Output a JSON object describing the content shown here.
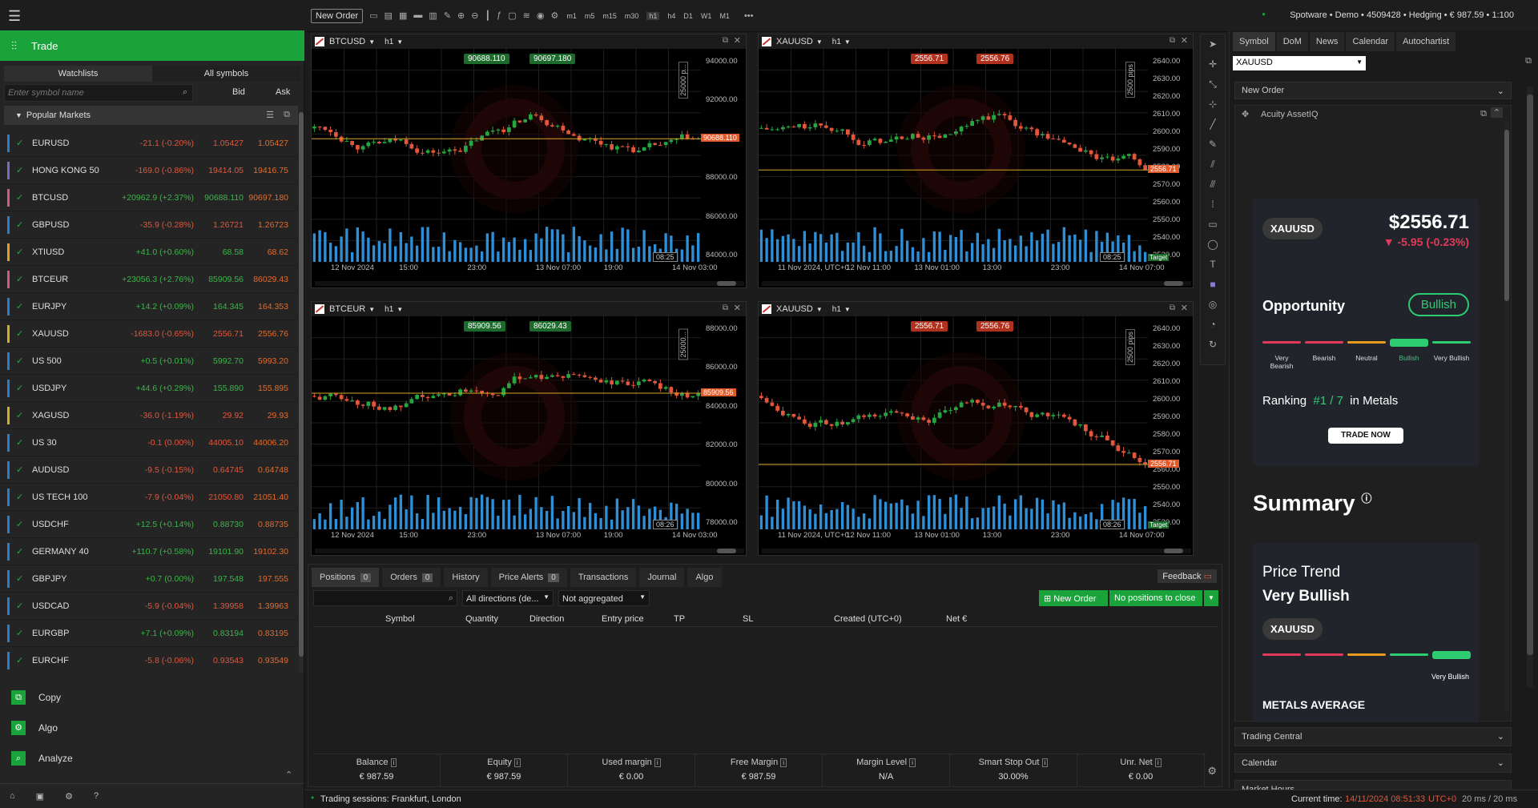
{
  "sidebar": {
    "trade_label": "Trade",
    "tabs": [
      "Watchlists",
      "All symbols"
    ],
    "search_placeholder": "Enter symbol name",
    "bid_label": "Bid",
    "ask_label": "Ask",
    "section_title": "Popular Markets",
    "markets": [
      {
        "symbol": "EURUSD",
        "change": "-21.1 (-0.20%)",
        "bid": "1.05427",
        "ask": "1.05427",
        "dir": "neg",
        "color": "#2a7cc7"
      },
      {
        "symbol": "HONG KONG 50",
        "change": "-169.0 (-0.86%)",
        "bid": "19414.05",
        "ask": "19416.75",
        "dir": "neg",
        "color": "#7f6ac2"
      },
      {
        "symbol": "BTCUSD",
        "change": "+20962.9 (+2.37%)",
        "bid": "90688.110",
        "ask": "90697.180",
        "dir": "pos",
        "color": "#d05a7a"
      },
      {
        "symbol": "GBPUSD",
        "change": "-35.9 (-0.28%)",
        "bid": "1.26721",
        "ask": "1.26723",
        "dir": "neg",
        "color": "#2a7cc7"
      },
      {
        "symbol": "XTIUSD",
        "change": "+41.0 (+0.60%)",
        "bid": "68.58",
        "ask": "68.62",
        "dir": "pos",
        "color": "#e0a020"
      },
      {
        "symbol": "BTCEUR",
        "change": "+23056.3 (+2.76%)",
        "bid": "85909.56",
        "ask": "86029.43",
        "dir": "pos",
        "color": "#d05a7a"
      },
      {
        "symbol": "EURJPY",
        "change": "+14.2 (+0.09%)",
        "bid": "164.345",
        "ask": "164.353",
        "dir": "pos",
        "color": "#2a7cc7"
      },
      {
        "symbol": "XAUUSD",
        "change": "-1683.0 (-0.65%)",
        "bid": "2556.71",
        "ask": "2556.76",
        "dir": "neg",
        "color": "#d0b020"
      },
      {
        "symbol": "US 500",
        "change": "+0.5 (+0.01%)",
        "bid": "5992.70",
        "ask": "5993.20",
        "dir": "pos",
        "color": "#2a7cc7"
      },
      {
        "symbol": "USDJPY",
        "change": "+44.6 (+0.29%)",
        "bid": "155.890",
        "ask": "155.895",
        "dir": "pos",
        "color": "#2a7cc7"
      },
      {
        "symbol": "XAGUSD",
        "change": "-36.0 (-1.19%)",
        "bid": "29.92",
        "ask": "29.93",
        "dir": "neg",
        "color": "#d0b020"
      },
      {
        "symbol": "US 30",
        "change": "-0.1 (0.00%)",
        "bid": "44005.10",
        "ask": "44006.20",
        "dir": "neg",
        "color": "#2a7cc7"
      },
      {
        "symbol": "AUDUSD",
        "change": "-9.5 (-0.15%)",
        "bid": "0.64745",
        "ask": "0.64748",
        "dir": "neg",
        "color": "#2a7cc7"
      },
      {
        "symbol": "US TECH 100",
        "change": "-7.9 (-0.04%)",
        "bid": "21050.80",
        "ask": "21051.40",
        "dir": "neg",
        "color": "#2a7cc7"
      },
      {
        "symbol": "USDCHF",
        "change": "+12.5 (+0.14%)",
        "bid": "0.88730",
        "ask": "0.88735",
        "dir": "pos",
        "color": "#2a7cc7"
      },
      {
        "symbol": "GERMANY 40",
        "change": "+110.7 (+0.58%)",
        "bid": "19101.90",
        "ask": "19102.30",
        "dir": "pos",
        "color": "#2a7cc7"
      },
      {
        "symbol": "GBPJPY",
        "change": "+0.7 (0.00%)",
        "bid": "197.548",
        "ask": "197.555",
        "dir": "pos",
        "color": "#2a7cc7"
      },
      {
        "symbol": "USDCAD",
        "change": "-5.9 (-0.04%)",
        "bid": "1.39958",
        "ask": "1.39963",
        "dir": "neg",
        "color": "#2a7cc7"
      },
      {
        "symbol": "EURGBP",
        "change": "+7.1 (+0.09%)",
        "bid": "0.83194",
        "ask": "0.83195",
        "dir": "pos",
        "color": "#2a7cc7"
      },
      {
        "symbol": "EURCHF",
        "change": "-5.8 (-0.06%)",
        "bid": "0.93543",
        "ask": "0.93549",
        "dir": "neg",
        "color": "#2a7cc7"
      }
    ],
    "bottom_nav": [
      "Copy",
      "Algo",
      "Analyze"
    ]
  },
  "topbar": {
    "new_order": "New Order",
    "timeframes": [
      "m1",
      "m5",
      "m15",
      "m30",
      "h1",
      "h4",
      "D1",
      "W1",
      "M1"
    ],
    "account": "Spotware • Demo • 4509428 • Hedging • € 987.59 • 1:100"
  },
  "charts": [
    {
      "symbol": "BTCUSD",
      "tf": "h1",
      "bid": "90688.110",
      "ask": "90697.180",
      "price_tag": "90688.110",
      "y_axis": [
        "94000.00",
        "92000.00",
        "90000.00",
        "88000.00",
        "86000.00",
        "84000.00"
      ],
      "x_axis": [
        "12 Nov 2024",
        "15:00",
        "23:00",
        "13 Nov 07:00",
        "19:00",
        "14 Nov 03:00"
      ],
      "pips": "25000 p...",
      "time_box": "08:25"
    },
    {
      "symbol": "XAUUSD",
      "tf": "h1",
      "bid": "2556.71",
      "ask": "2556.76",
      "price_tag": "2556.71",
      "y_axis": [
        "2640.00",
        "2630.00",
        "2620.00",
        "2610.00",
        "2600.00",
        "2590.00",
        "2580.00",
        "2570.00",
        "2560.00",
        "2550.00",
        "2540.00",
        "2530.00"
      ],
      "x_axis": [
        "11 Nov 2024, UTC+0",
        "12 Nov 11:00",
        "13 Nov 01:00",
        "13:00",
        "23:00",
        "14 Nov 07:00"
      ],
      "pips": "2500 pips",
      "time_box": "08:25",
      "target": "Target"
    },
    {
      "symbol": "BTCEUR",
      "tf": "h1",
      "bid": "85909.56",
      "ask": "86029.43",
      "price_tag": "85909.56",
      "y_axis": [
        "88000.00",
        "86000.00",
        "84000.00",
        "82000.00",
        "80000.00",
        "78000.00"
      ],
      "x_axis": [
        "12 Nov 2024",
        "15:00",
        "23:00",
        "13 Nov 07:00",
        "19:00",
        "14 Nov 03:00"
      ],
      "pips": "25000...",
      "time_box": "08:26"
    },
    {
      "symbol": "XAUUSD",
      "tf": "h1",
      "bid": "2556.71",
      "ask": "2556.76",
      "price_tag": "2556.71",
      "y_axis": [
        "2640.00",
        "2630.00",
        "2620.00",
        "2610.00",
        "2600.00",
        "2590.00",
        "2580.00",
        "2570.00",
        "2560.00",
        "2550.00",
        "2540.00",
        "2530.00"
      ],
      "x_axis": [
        "11 Nov 2024, UTC+0",
        "12 Nov 11:00",
        "13 Nov 01:00",
        "13:00",
        "23:00",
        "14 Nov 07:00"
      ],
      "pips": "2500 pips",
      "time_box": "08:26",
      "target": "Target"
    }
  ],
  "positions": {
    "tabs": [
      {
        "label": "Positions",
        "count": "0"
      },
      {
        "label": "Orders",
        "count": "0"
      },
      {
        "label": "History"
      },
      {
        "label": "Price Alerts",
        "count": "0"
      },
      {
        "label": "Transactions"
      },
      {
        "label": "Journal"
      },
      {
        "label": "Algo"
      }
    ],
    "feedback": "Feedback",
    "directions": "All directions (de...",
    "aggregation": "Not aggregated",
    "new_order": "New Order",
    "no_positions": "No positions to close",
    "columns": [
      "Symbol",
      "Quantity",
      "Direction",
      "Entry price",
      "TP",
      "SL",
      "Created (UTC+0)",
      "Net €"
    ],
    "summary_labels": [
      "Balance",
      "Equity",
      "Used margin",
      "Free Margin",
      "Margin Level",
      "Smart Stop Out",
      "Unr. Net"
    ],
    "summary_values": [
      "€ 987.59",
      "€ 987.59",
      "€ 0.00",
      "€ 987.59",
      "N/A",
      "30.00%",
      "€ 0.00"
    ]
  },
  "right_panel": {
    "tabs": [
      "Symbol",
      "DoM",
      "News",
      "Calendar",
      "Autochartist"
    ],
    "symbol_select": "XAUUSD",
    "new_order": "New Order",
    "acuity": "Acuity AssetIQ",
    "card": {
      "symbol": "XAUUSD",
      "price": "$2556.71",
      "change": "-5.95 (-0.23%)",
      "opportunity": "Opportunity",
      "sentiment": "Bullish",
      "scale": [
        "Very Bearish",
        "Bearish",
        "Neutral",
        "Bullish",
        "Very Bullish"
      ],
      "ranking_label": "Ranking",
      "ranking": "#1 / 7",
      "ranking_suffix": "in Metals",
      "trade_now": "TRADE NOW"
    },
    "summary_title": "Summary",
    "trend_title": "Price Trend",
    "trend_value": "Very Bullish",
    "trend_symbol": "XAUUSD",
    "trend_scale_label": "Very Bullish",
    "metals": "METALS AVERAGE",
    "sections": [
      "Trading Central",
      "Calendar",
      "Market Hours"
    ]
  },
  "status": {
    "sessions": "Trading sessions: Frankfurt, London",
    "current_time_label": "Current time:",
    "current_time": "14/11/2024 08:51:33",
    "tz": "UTC+0",
    "latency": "20 ms / 20 ms"
  },
  "colors": {
    "bull": "#26a641",
    "bear": "#e2573c",
    "accent": "#1aa33b",
    "volume": "#2e8fd6"
  }
}
